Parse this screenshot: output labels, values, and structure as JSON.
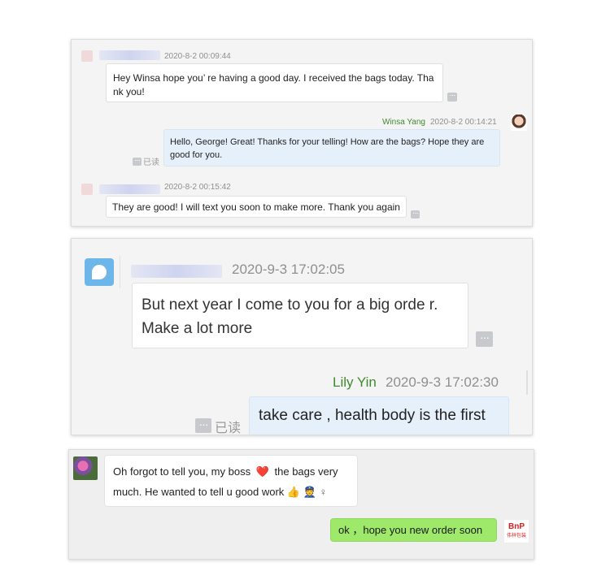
{
  "panel1": {
    "msg1": {
      "timestamp": "2020-8-2 00:09:44",
      "text": "Hey Winsa hope you’ re having a good day. I received the bags today. Tha nk you!"
    },
    "msg2": {
      "sender": "Winsa Yang",
      "timestamp": "2020-8-2 00:14:21",
      "text": "Hello, George! Great! Thanks for your telling! How are the bags? Hope they are good for you.",
      "read_label": "已读"
    },
    "msg3": {
      "timestamp": "2020-8-2 00:15:42",
      "text": "They are good! I will text you soon to make more. Thank you again"
    }
  },
  "panel2": {
    "msg1": {
      "timestamp": "2020-9-3 17:02:05",
      "text": "But next year I come to you for a big orde r. Make a lot more"
    },
    "msg2": {
      "sender": "Lily Yin",
      "timestamp": "2020-9-3 17:02:30",
      "text": "take care , health body is the first",
      "read_label": "已读"
    }
  },
  "panel3": {
    "msg1": {
      "text_before": "Oh forgot to tell you, my boss",
      "text_after": "the bags very",
      "line2": "much. He wanted to tell u good work",
      "emoji_heart": "❤️",
      "emoji_thumbs": "👍",
      "emoji_person": "👮",
      "emoji_female": "♀"
    },
    "msg2": {
      "text": "ok ，hope you new order soon"
    },
    "logo": {
      "mark": "BnP",
      "subtitle": "伟祥包装"
    }
  },
  "colors": {
    "sender_name": "#3f8a2e",
    "bubble_out": "#e6f0fb",
    "bubble_green": "#9ee86a"
  },
  "icons": {
    "more": "more-icon",
    "app": "app-avatar-icon"
  }
}
